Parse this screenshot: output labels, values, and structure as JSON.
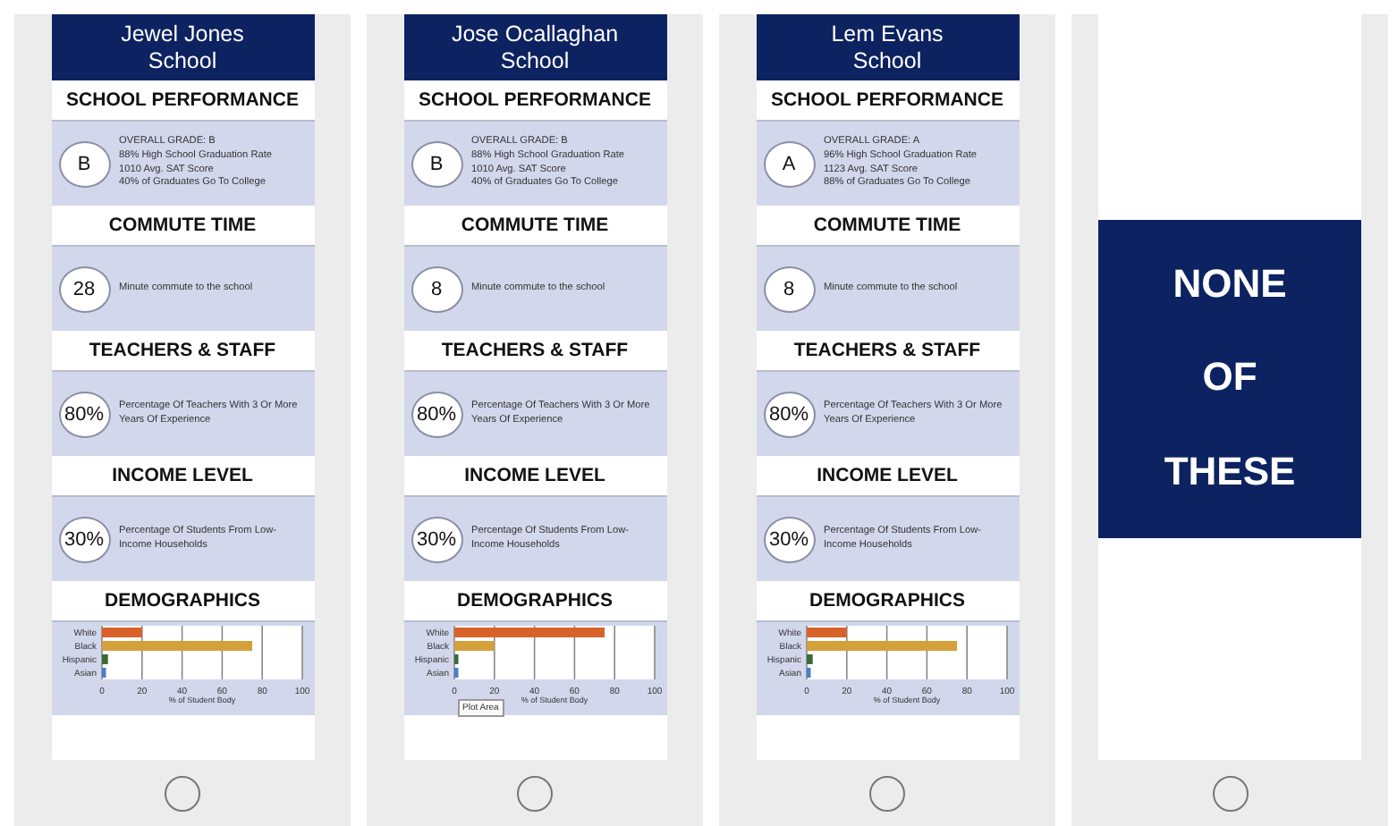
{
  "choices": [
    {
      "kind": "school",
      "selected": false,
      "title": "Jewel Jones School",
      "sections": [
        {
          "kind": "stat",
          "heading": "SCHOOL PERFORMANCE",
          "badge": "B",
          "lines": [
            "OVERALL GRADE: B",
            "88% High School Graduation Rate",
            "1010 Avg. SAT Score",
            "40% of Graduates Go To College"
          ]
        },
        {
          "kind": "stat",
          "heading": "COMMUTE TIME",
          "badge": "28",
          "lines": [
            "Minute commute to the school"
          ]
        },
        {
          "kind": "stat",
          "heading": "TEACHERS & STAFF",
          "badge": "80%",
          "lines": [
            "Percentage Of Teachers With 3 Or More Years Of Experience"
          ]
        },
        {
          "kind": "stat",
          "heading": "INCOME LEVEL",
          "badge": "30%",
          "lines": [
            "Percentage Of Students From Low-Income Households"
          ]
        },
        {
          "kind": "chart",
          "heading": "DEMOGRAPHICS",
          "chart_data": {
            "type": "bar",
            "orientation": "horizontal",
            "grid": true,
            "categories": [
              "White",
              "Black",
              "Hispanic",
              "Asian"
            ],
            "colors": [
              "#d9622b",
              "#d4a03a",
              "#3b6b34",
              "#4a7cc9"
            ],
            "xlabel": "% of Student Body",
            "xlim": [
              0,
              100
            ],
            "xticks": [
              0,
              20,
              40,
              60,
              80,
              100
            ],
            "series": [
              {
                "values": [
                  20,
                  75,
                  3,
                  2
                ]
              }
            ]
          }
        }
      ]
    },
    {
      "kind": "school",
      "selected": false,
      "title": "Jose Ocallaghan School",
      "sections": [
        {
          "kind": "stat",
          "heading": "SCHOOL PERFORMANCE",
          "badge": "B",
          "lines": [
            "OVERALL GRADE: B",
            "88% High School Graduation Rate",
            "1010 Avg. SAT Score",
            "40% of Graduates Go To College"
          ]
        },
        {
          "kind": "stat",
          "heading": "COMMUTE TIME",
          "badge": "8",
          "lines": [
            "Minute commute to the school"
          ]
        },
        {
          "kind": "stat",
          "heading": "TEACHERS & STAFF",
          "badge": "80%",
          "lines": [
            "Percentage Of Teachers With 3 Or More Years Of Experience"
          ]
        },
        {
          "kind": "stat",
          "heading": "INCOME LEVEL",
          "badge": "30%",
          "lines": [
            "Percentage Of Students From Low-Income Households"
          ]
        },
        {
          "kind": "chart",
          "heading": "DEMOGRAPHICS",
          "tooltip": "Plot Area",
          "chart_data": {
            "type": "bar",
            "orientation": "horizontal",
            "grid": true,
            "categories": [
              "White",
              "Black",
              "Hispanic",
              "Asian"
            ],
            "colors": [
              "#d9622b",
              "#d4a03a",
              "#3b6b34",
              "#4a7cc9"
            ],
            "xlabel": "% of Student Body",
            "xlim": [
              0,
              100
            ],
            "xticks": [
              0,
              20,
              40,
              60,
              80,
              100
            ],
            "series": [
              {
                "values": [
                  75,
                  20,
                  2,
                  2
                ]
              }
            ]
          }
        }
      ]
    },
    {
      "kind": "school",
      "selected": false,
      "title": "Lem Evans School",
      "sections": [
        {
          "kind": "stat",
          "heading": "SCHOOL PERFORMANCE",
          "badge": "A",
          "lines": [
            "OVERALL GRADE: A",
            "96% High School Graduation Rate",
            "1123 Avg. SAT Score",
            "88% of Graduates Go To College"
          ]
        },
        {
          "kind": "stat",
          "heading": "COMMUTE TIME",
          "badge": "8",
          "lines": [
            "Minute commute to the school"
          ]
        },
        {
          "kind": "stat",
          "heading": "TEACHERS & STAFF",
          "badge": "80%",
          "lines": [
            "Percentage Of Teachers With 3 Or More Years Of Experience"
          ]
        },
        {
          "kind": "stat",
          "heading": "INCOME LEVEL",
          "badge": "30%",
          "lines": [
            "Percentage Of Students From Low-Income Households"
          ]
        },
        {
          "kind": "chart",
          "heading": "DEMOGRAPHICS",
          "chart_data": {
            "type": "bar",
            "orientation": "horizontal",
            "grid": true,
            "categories": [
              "White",
              "Black",
              "Hispanic",
              "Asian"
            ],
            "colors": [
              "#d9622b",
              "#d4a03a",
              "#3b6b34",
              "#4a7cc9"
            ],
            "xlabel": "% of Student Body",
            "xlim": [
              0,
              100
            ],
            "xticks": [
              0,
              20,
              40,
              60,
              80,
              100
            ],
            "series": [
              {
                "values": [
                  20,
                  75,
                  3,
                  2
                ]
              }
            ]
          }
        }
      ]
    },
    {
      "kind": "none",
      "selected": false,
      "lines": [
        "NONE",
        "OF",
        "THESE"
      ]
    }
  ]
}
